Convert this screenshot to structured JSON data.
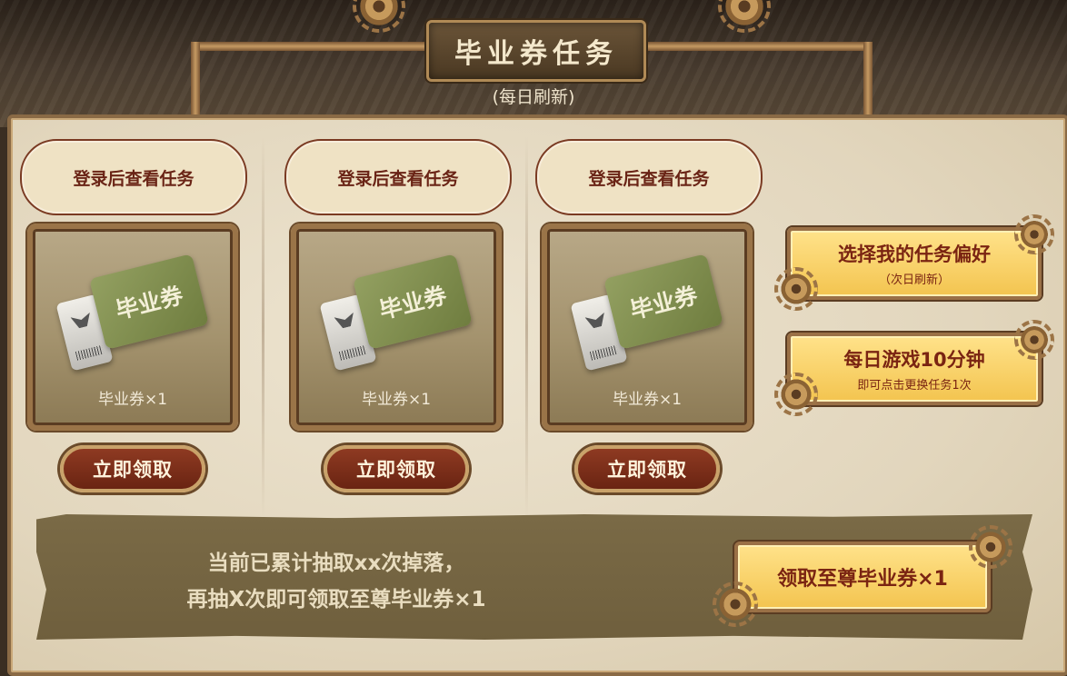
{
  "header": {
    "title": "毕业券任务",
    "subtitle": "(每日刷新)"
  },
  "tasks": [
    {
      "task_text": "登录后查看任务",
      "reward_name": "毕业券",
      "reward_label": "毕业券×1",
      "claim_label": "立即领取"
    },
    {
      "task_text": "登录后查看任务",
      "reward_name": "毕业券",
      "reward_label": "毕业券×1",
      "claim_label": "立即领取"
    },
    {
      "task_text": "登录后查看任务",
      "reward_name": "毕业券",
      "reward_label": "毕业券×1",
      "claim_label": "立即领取"
    }
  ],
  "side": {
    "preference": {
      "main": "选择我的任务偏好",
      "sub": "（次日刷新）"
    },
    "daily": {
      "main": "每日游戏10分钟",
      "sub": "即可点击更换任务1次"
    }
  },
  "bottom": {
    "progress_line1": "当前已累计抽取xx次掉落，",
    "progress_line2": "再抽X次即可领取至尊毕业券×1",
    "supreme_button": "领取至尊毕业券×1"
  }
}
